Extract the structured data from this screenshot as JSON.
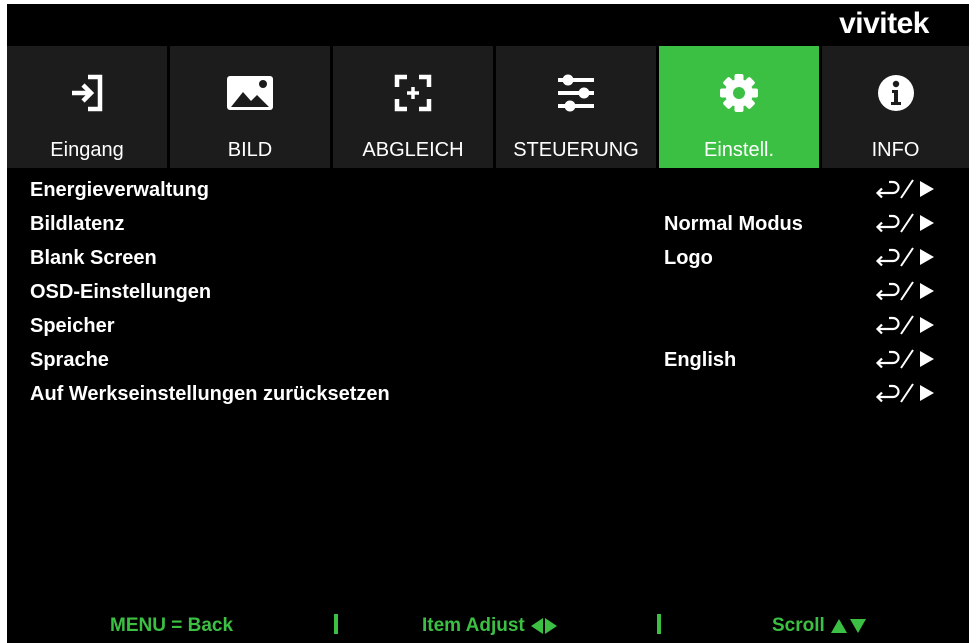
{
  "brand": {
    "logo_text": "vivitek"
  },
  "tabs": [
    {
      "label": "Eingang",
      "icon": "input-icon",
      "selected": false
    },
    {
      "label": "BILD",
      "icon": "image-icon",
      "selected": false
    },
    {
      "label": "ABGLEICH",
      "icon": "alignment-icon",
      "selected": false
    },
    {
      "label": "STEUERUNG",
      "icon": "sliders-icon",
      "selected": false
    },
    {
      "label": "Einstell.",
      "icon": "gear-icon",
      "selected": true
    },
    {
      "label": "INFO",
      "icon": "info-icon",
      "selected": false
    }
  ],
  "menu": {
    "items": [
      {
        "label": "Energieverwaltung",
        "value": "",
        "action_icon": "enter-right-icon"
      },
      {
        "label": "Bildlatenz",
        "value": "Normal Modus",
        "action_icon": "enter-right-icon"
      },
      {
        "label": "Blank Screen",
        "value": "Logo",
        "action_icon": "enter-right-icon"
      },
      {
        "label": "OSD-Einstellungen",
        "value": "",
        "action_icon": "enter-right-icon"
      },
      {
        "label": "Speicher",
        "value": "",
        "action_icon": "enter-right-icon"
      },
      {
        "label": "Sprache",
        "value": "English",
        "action_icon": "enter-right-icon"
      },
      {
        "label": "Auf Werkseinstellungen zurücksetzen",
        "value": "",
        "action_icon": "enter-right-icon"
      }
    ]
  },
  "footer": {
    "back_hint": "MENU = Back",
    "adjust_hint": "Item Adjust",
    "scroll_hint": "Scroll"
  },
  "colors": {
    "accent": "#3cc043",
    "background": "#000000",
    "tab_background": "#1c1c1c",
    "text": "#ffffff"
  }
}
